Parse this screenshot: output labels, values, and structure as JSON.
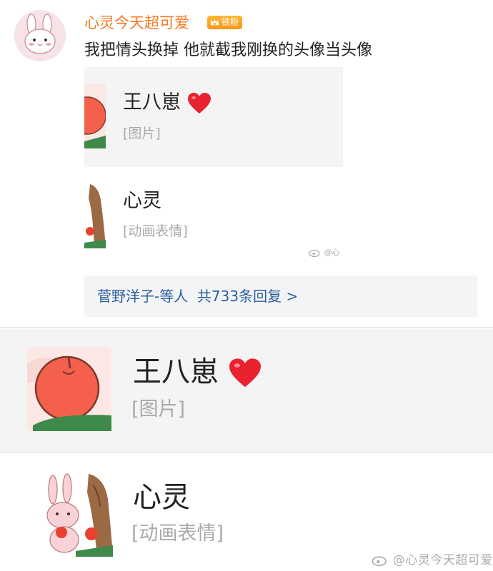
{
  "comment": {
    "username": "心灵今天超可爱",
    "badge": "铁粉",
    "text": "我把情头换掉 他就截我刚换的头像当头像"
  },
  "chat": {
    "messages": [
      {
        "name": "王八崽",
        "heart": "❤",
        "content": "[图片]"
      },
      {
        "name": "心灵",
        "content": "[动画表情]"
      }
    ],
    "watermark_small": "@心",
    "watermark_large": "@心灵今天超可爱"
  },
  "replies": {
    "text": "菅野洋子-等人  共733条回复 >"
  },
  "colors": {
    "username": "#f57a23",
    "badge": "#f5a623",
    "reply_link": "#2c5e9c",
    "heart": "#e8232f"
  },
  "icons": [
    "bunny-avatar-icon",
    "fan-badge-crown-icon",
    "apple-avatar-icon",
    "heart-icon",
    "weibo-logo-icon"
  ]
}
